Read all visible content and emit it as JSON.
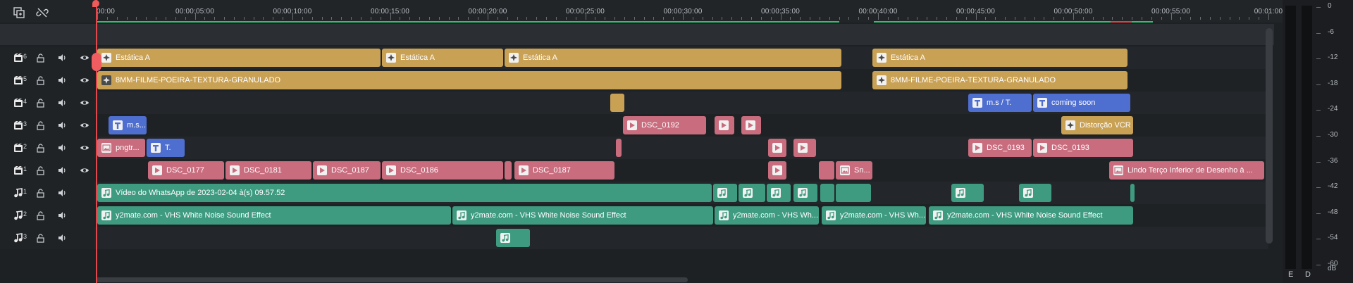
{
  "toolbar": {
    "buttons": [
      {
        "name": "copy-icon"
      },
      {
        "name": "unlink-icon"
      }
    ]
  },
  "ruler": {
    "labels": [
      "00:00",
      "00:00:05:00",
      "00:00:10:00",
      "00:00:15:00",
      "00:00:20:00",
      "00:00:25:00",
      "00:00:30:00",
      "00:00:35:00",
      "00:00:40:00",
      "00:00:45:00",
      "00:00:50:00",
      "00:00:55:00",
      "00:01:00"
    ]
  },
  "tracks": [
    {
      "type": "video",
      "num": "6"
    },
    {
      "type": "video",
      "num": "5"
    },
    {
      "type": "video",
      "num": "4"
    },
    {
      "type": "video",
      "num": "3"
    },
    {
      "type": "video",
      "num": "2"
    },
    {
      "type": "video",
      "num": "1"
    },
    {
      "type": "audio",
      "num": "1"
    },
    {
      "type": "audio",
      "num": "2"
    },
    {
      "type": "audio",
      "num": "3"
    }
  ],
  "clips": {
    "v6": [
      "Estática A",
      "Estática A",
      "Estática A",
      "Estática A"
    ],
    "v5": [
      "8MM-FILME-POEIRA-TEXTURA-GRANULADO",
      "8MM-FILME-POEIRA-TEXTURA-GRANULADO"
    ],
    "v4": [
      "m.s / T.",
      "coming soon"
    ],
    "v3": [
      "m.s...",
      "DSC_0192",
      "Distorção VCR"
    ],
    "v2": [
      "pngtr...",
      "T.",
      "DSC_0193",
      "DSC_0193"
    ],
    "v1": [
      "DSC_0177",
      "DSC_0181",
      "DSC_0187",
      "DSC_0186",
      "DSC_0187",
      "Sn...",
      "Lindo Terço Inferior de Desenho à ..."
    ],
    "a1": [
      "Vídeo do WhatsApp de 2023-02-04 à(s) 09.57.52"
    ],
    "a2": [
      "y2mate.com - VHS White Noise Sound Effect",
      "y2mate.com - VHS White Noise Sound Effect",
      "y2mate.com - VHS Wh...",
      "y2mate.com - VHS Wh...",
      "y2mate.com - VHS White Noise Sound Effect"
    ]
  },
  "meter": {
    "db_labels": [
      "0",
      "-6",
      "-12",
      "-18",
      "-24",
      "-30",
      "-36",
      "-42",
      "-48",
      "-54",
      "-60",
      "dB"
    ],
    "channels": [
      "E",
      "D"
    ]
  },
  "colors": {
    "video_clip": "#c86c7e",
    "effect_clip": "#c9a155",
    "title_clip": "#4f6fd0",
    "audio_clip": "#3e9b80",
    "playhead": "#e2484c"
  }
}
